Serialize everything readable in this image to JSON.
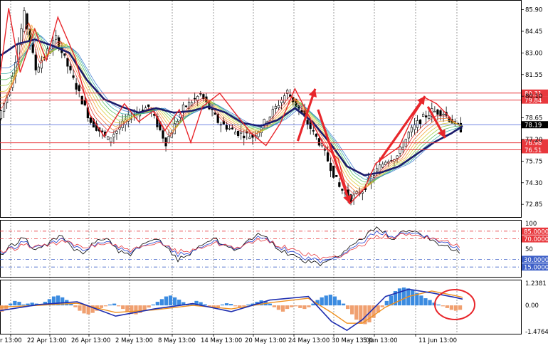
{
  "chart_data": [
    {
      "panel": "price",
      "type": "candlestick",
      "ylim": [
        72.0,
        86.5
      ],
      "y_ticks": [
        "85.90",
        "84.45",
        "83.00",
        "81.55",
        "80.10",
        "78.65",
        "77.20",
        "75.75",
        "74.30",
        "72.85"
      ],
      "current_price_label": "78.19",
      "horizontal_levels": [
        {
          "label": "80.31",
          "value": 80.31
        },
        {
          "label": "79.84",
          "value": 79.84
        },
        {
          "label": "76.98",
          "value": 76.98
        },
        {
          "label": "76.51",
          "value": 76.51
        }
      ],
      "close_path": [
        [
          0,
          78.6
        ],
        [
          4,
          80.6
        ],
        [
          9,
          85.6
        ],
        [
          13,
          81.9
        ],
        [
          20,
          84.0
        ],
        [
          26,
          81.2
        ],
        [
          32,
          78.4
        ],
        [
          38,
          77.2
        ],
        [
          46,
          78.8
        ],
        [
          52,
          79.4
        ],
        [
          58,
          77.0
        ],
        [
          64,
          79.3
        ],
        [
          70,
          80.2
        ],
        [
          76,
          78.4
        ],
        [
          82,
          77.7
        ],
        [
          88,
          77.4
        ],
        [
          94,
          78.8
        ],
        [
          100,
          80.4
        ],
        [
          106,
          78.6
        ],
        [
          112,
          76.7
        ],
        [
          118,
          74.0
        ],
        [
          122,
          73.2
        ],
        [
          126,
          73.8
        ],
        [
          130,
          74.9
        ],
        [
          134,
          75.8
        ],
        [
          138,
          76.1
        ],
        [
          142,
          77.6
        ],
        [
          146,
          78.5
        ],
        [
          150,
          79.1
        ],
        [
          154,
          79.0
        ],
        [
          158,
          78.2
        ],
        [
          160,
          77.9
        ]
      ],
      "ribbon_path": [
        [
          0,
          82.8
        ],
        [
          6,
          83.6
        ],
        [
          12,
          83.9
        ],
        [
          18,
          83.5
        ],
        [
          24,
          83.0
        ],
        [
          30,
          81.2
        ],
        [
          36,
          79.9
        ],
        [
          42,
          79.4
        ],
        [
          48,
          79.0
        ],
        [
          54,
          79.3
        ],
        [
          60,
          79.0
        ],
        [
          66,
          79.1
        ],
        [
          72,
          79.4
        ],
        [
          78,
          79.0
        ],
        [
          84,
          78.3
        ],
        [
          90,
          78.1
        ],
        [
          96,
          78.5
        ],
        [
          102,
          79.3
        ],
        [
          108,
          78.4
        ],
        [
          114,
          77.0
        ],
        [
          120,
          75.4
        ],
        [
          126,
          74.8
        ],
        [
          132,
          75.0
        ],
        [
          138,
          75.4
        ],
        [
          144,
          76.2
        ],
        [
          150,
          77.0
        ],
        [
          156,
          77.6
        ],
        [
          160,
          78.1
        ]
      ],
      "annotation_arrows": [
        {
          "from": [
            103,
            77.1
          ],
          "to": [
            109,
            80.6
          ]
        },
        {
          "from": [
            110,
            79.2
          ],
          "to": [
            121,
            72.9
          ]
        },
        {
          "from": [
            131,
            75.7
          ],
          "to": [
            147,
            80.1
          ]
        },
        {
          "from": [
            148,
            79.4
          ],
          "to": [
            154,
            77.3
          ]
        }
      ],
      "zigzag": [
        [
          0,
          81.5
        ],
        [
          3,
          86.0
        ],
        [
          7,
          81.7
        ],
        [
          12,
          84.6
        ],
        [
          16,
          82.5
        ],
        [
          20,
          85.4
        ],
        [
          26,
          82.7
        ],
        [
          31,
          78.9
        ],
        [
          36,
          77.4
        ],
        [
          43,
          79.6
        ],
        [
          48,
          78.4
        ],
        [
          53,
          79.1
        ],
        [
          57,
          77.8
        ],
        [
          62,
          79.2
        ],
        [
          66,
          77.0
        ],
        [
          70,
          79.4
        ],
        [
          76,
          80.3
        ],
        [
          82,
          78.8
        ],
        [
          87,
          77.6
        ],
        [
          92,
          76.8
        ],
        [
          97,
          78.3
        ],
        [
          102,
          80.6
        ],
        [
          106,
          79.1
        ],
        [
          112,
          76.8
        ],
        [
          117,
          75.9
        ],
        [
          121,
          72.9
        ],
        [
          126,
          73.9
        ],
        [
          130,
          75.6
        ],
        [
          138,
          76.7
        ],
        [
          143,
          78.8
        ],
        [
          147,
          80.0
        ],
        [
          151,
          79.6
        ],
        [
          156,
          78.6
        ]
      ]
    },
    {
      "panel": "oscillator",
      "type": "line",
      "ylim": [
        0,
        100
      ],
      "y_ticks": [
        "100",
        "50"
      ],
      "levels": [
        {
          "label": "85.0000",
          "value": 85,
          "color": "#e8383d"
        },
        {
          "label": "70.0000",
          "value": 70,
          "color": "#e8383d"
        },
        {
          "label": "30.0000",
          "value": 30,
          "color": "#3e60c8"
        },
        {
          "label": "15.0000",
          "value": 15,
          "color": "#3e60c8"
        }
      ],
      "series": [
        {
          "color": "#000000",
          "values": [
            36,
            58,
            72,
            48,
            60,
            78,
            52,
            40,
            66,
            72,
            44,
            40,
            56,
            70,
            56,
            30,
            40,
            60,
            72,
            56,
            50,
            66,
            80,
            60,
            44,
            34,
            24,
            20,
            30,
            46,
            62,
            80,
            92,
            70,
            84,
            86,
            74,
            60,
            52,
            44
          ]
        },
        {
          "color": "#1f3fd0",
          "values": [
            40,
            52,
            64,
            54,
            58,
            70,
            58,
            46,
            60,
            66,
            50,
            44,
            52,
            64,
            58,
            40,
            42,
            56,
            66,
            58,
            52,
            62,
            74,
            62,
            50,
            40,
            30,
            26,
            30,
            42,
            56,
            72,
            84,
            76,
            80,
            82,
            76,
            66,
            58,
            50
          ]
        },
        {
          "color": "#e8383d",
          "values": [
            44,
            50,
            58,
            56,
            58,
            64,
            60,
            52,
            58,
            62,
            54,
            48,
            52,
            60,
            58,
            46,
            46,
            54,
            62,
            58,
            54,
            60,
            68,
            62,
            54,
            46,
            38,
            32,
            34,
            40,
            52,
            64,
            76,
            74,
            78,
            78,
            74,
            68,
            62,
            56
          ]
        }
      ]
    },
    {
      "panel": "macd",
      "type": "bar",
      "ylim": [
        -1.55,
        1.32
      ],
      "y_ticks": [
        "1.2381",
        "0.00",
        "-1.4764"
      ],
      "histogram": [
        -0.35,
        -0.25,
        0.1,
        0.25,
        0.2,
        0.05,
        0.1,
        0.15,
        0.1,
        0.05,
        0.2,
        0.35,
        0.5,
        0.55,
        0.45,
        0.3,
        0.1,
        -0.1,
        -0.3,
        -0.45,
        -0.5,
        -0.42,
        -0.3,
        -0.15,
        -0.05,
        0.05,
        0.1,
        -0.05,
        -0.2,
        -0.35,
        -0.48,
        -0.5,
        -0.42,
        -0.28,
        -0.12,
        0.05,
        0.2,
        0.35,
        0.5,
        0.55,
        0.45,
        0.32,
        0.18,
        0.05,
        0.12,
        0.25,
        0.18,
        0.06,
        -0.1,
        -0.15,
        -0.1,
        0.05,
        0.12,
        0.08,
        -0.05,
        -0.12,
        -0.05,
        0.05,
        0.1,
        0.2,
        0.28,
        0.22,
        0.1,
        -0.1,
        -0.25,
        -0.35,
        -0.2,
        -0.1,
        -0.05,
        -0.15,
        -0.2,
        -0.1,
        0.1,
        0.3,
        0.45,
        0.55,
        0.6,
        0.5,
        0.3,
        0.1,
        -0.2,
        -0.5,
        -0.8,
        -1.0,
        -1.05,
        -0.95,
        -0.7,
        -0.4,
        -0.1,
        0.25,
        0.55,
        0.8,
        0.95,
        1.0,
        0.95,
        0.85,
        0.7,
        0.55,
        0.4,
        0.3,
        0.15,
        0.05,
        -0.05,
        -0.15,
        -0.25,
        -0.3,
        -0.25
      ],
      "macd_line": [
        [
          0,
          -0.3
        ],
        [
          10,
          0.05
        ],
        [
          20,
          0.2
        ],
        [
          30,
          -0.6
        ],
        [
          40,
          -0.2
        ],
        [
          50,
          0.1
        ],
        [
          60,
          -0.35
        ],
        [
          70,
          0.3
        ],
        [
          80,
          0.5
        ],
        [
          86,
          -0.9
        ],
        [
          90,
          -1.4
        ],
        [
          94,
          -0.8
        ],
        [
          100,
          0.5
        ],
        [
          106,
          0.9
        ],
        [
          112,
          0.7
        ],
        [
          118,
          0.45
        ],
        [
          120,
          0.35
        ]
      ],
      "signal_line": [
        [
          0,
          -0.1
        ],
        [
          10,
          0.0
        ],
        [
          20,
          0.12
        ],
        [
          30,
          -0.4
        ],
        [
          40,
          -0.25
        ],
        [
          50,
          0.0
        ],
        [
          60,
          -0.2
        ],
        [
          70,
          0.15
        ],
        [
          80,
          0.4
        ],
        [
          86,
          -0.4
        ],
        [
          90,
          -1.0
        ],
        [
          94,
          -1.0
        ],
        [
          100,
          -0.1
        ],
        [
          106,
          0.5
        ],
        [
          112,
          0.8
        ],
        [
          118,
          0.55
        ],
        [
          120,
          0.45
        ]
      ]
    }
  ],
  "x_axis": {
    "ticks": [
      "r 13:00",
      "22 Apr 13:00",
      "26 Apr 13:00",
      "2 May 13:00",
      "8 May 13:00",
      "14 May 13:00",
      "20 May 13:00",
      "24 May 13:00",
      "30 May 13:00",
      "5 Jun 13:00",
      "11 Jun 13:00"
    ],
    "grid": "vertical-dotted"
  },
  "colors": {
    "background": "#ffffff",
    "axis": "#000000",
    "level_red": "#e8383d",
    "price_label_blue": "#1f3fd0",
    "arrow": "#e8262b",
    "ma_dark": "#1b1b6b",
    "macd_pos": "#3b8be0",
    "macd_neg": "#f0a070",
    "highlight_circle": "#e8262b"
  }
}
